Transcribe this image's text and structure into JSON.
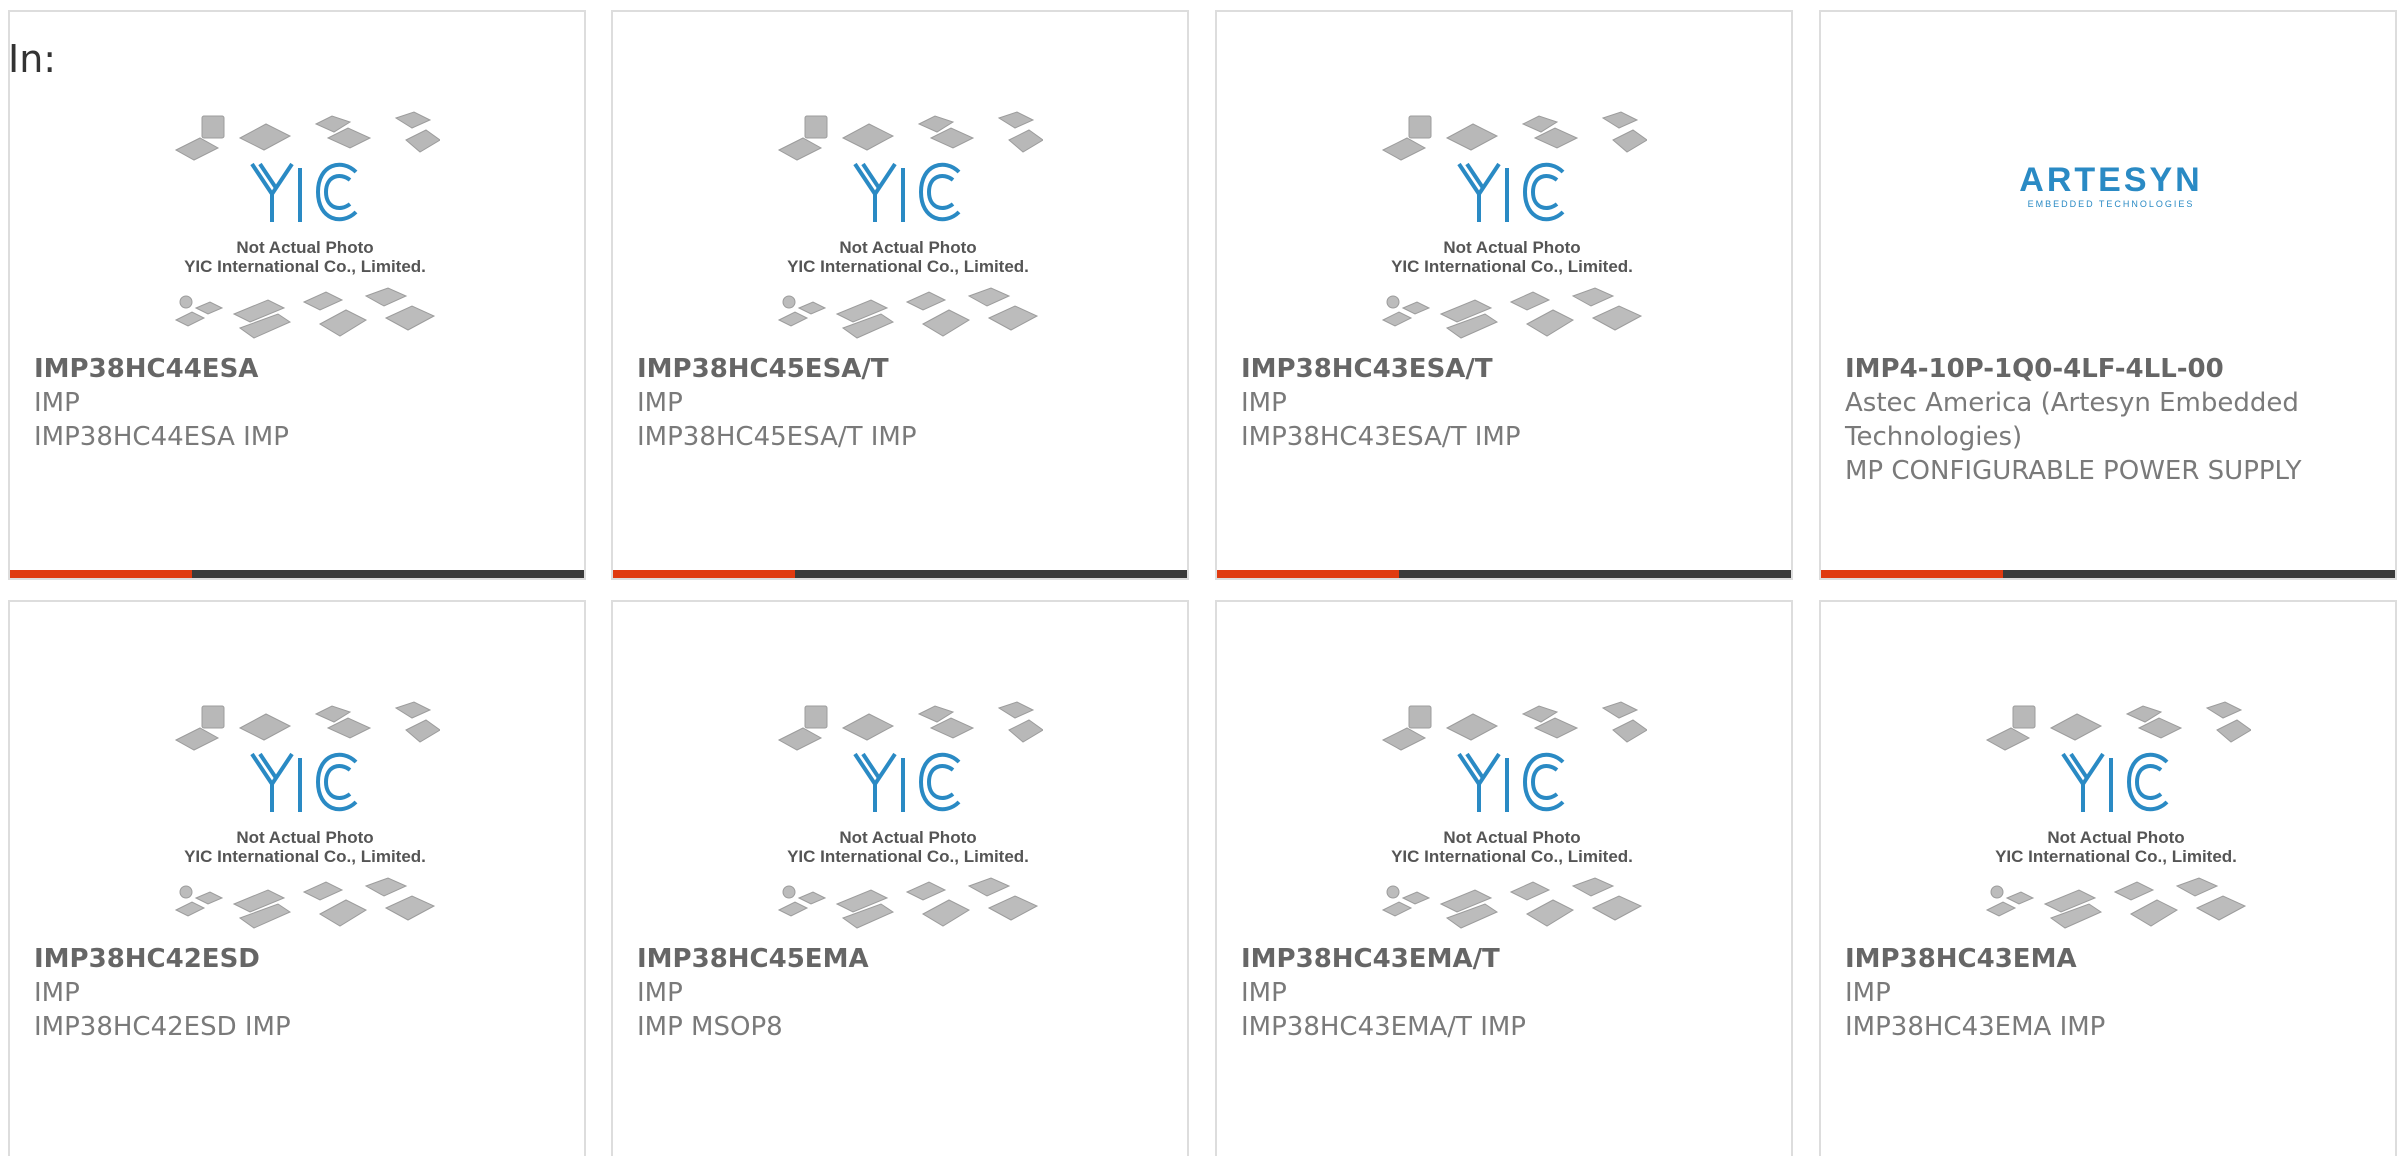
{
  "header": {
    "in_label": "In:"
  },
  "placeholder": {
    "line1": "Not Actual Photo",
    "line2": "YIC International Co., Limited.",
    "logo_text": "YIC"
  },
  "brand": {
    "name": "ARTESYN",
    "tagline": "EMBEDDED TECHNOLOGIES"
  },
  "colors": {
    "accent": "#e03a10",
    "bar": "#3a3a3a",
    "logo_blue": "#2a8ac4"
  },
  "products": [
    {
      "part": "IMP38HC44ESA",
      "maker": "IMP",
      "desc": "IMP38HC44ESA IMP",
      "image": "yic-placeholder"
    },
    {
      "part": "IMP38HC45ESA/T",
      "maker": "IMP",
      "desc": "IMP38HC45ESA/T IMP",
      "image": "yic-placeholder"
    },
    {
      "part": "IMP38HC43ESA/T",
      "maker": "IMP",
      "desc": "IMP38HC43ESA/T IMP",
      "image": "yic-placeholder"
    },
    {
      "part": "IMP4-10P-1Q0-4LF-4LL-00",
      "maker": "Astec America (Artesyn Embedded Technologies)",
      "desc": "MP CONFIGURABLE POWER SUPPLY",
      "image": "artesyn-logo"
    },
    {
      "part": "IMP38HC42ESD",
      "maker": "IMP",
      "desc": "IMP38HC42ESD IMP",
      "image": "yic-placeholder"
    },
    {
      "part": "IMP38HC45EMA",
      "maker": "IMP",
      "desc": "IMP MSOP8",
      "image": "yic-placeholder"
    },
    {
      "part": "IMP38HC43EMA/T",
      "maker": "IMP",
      "desc": "IMP38HC43EMA/T IMP",
      "image": "yic-placeholder"
    },
    {
      "part": "IMP38HC43EMA",
      "maker": "IMP",
      "desc": "IMP38HC43EMA IMP",
      "image": "yic-placeholder"
    }
  ]
}
